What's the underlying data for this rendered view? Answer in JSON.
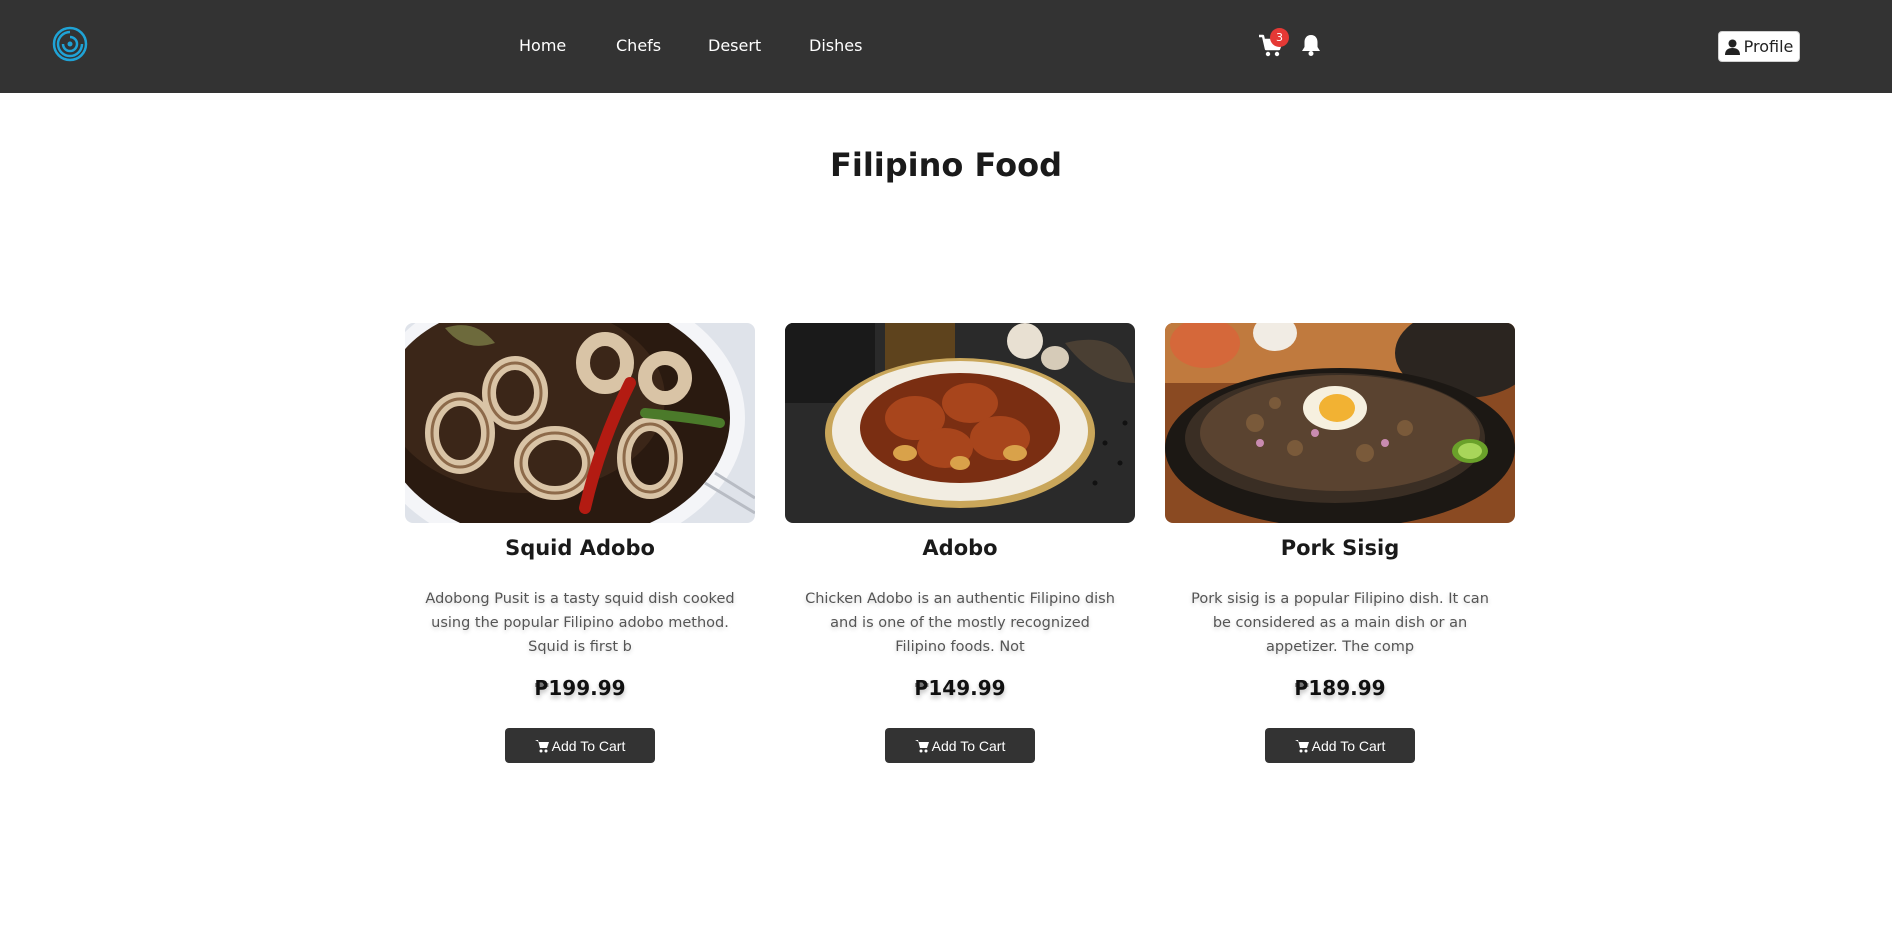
{
  "nav": {
    "links": [
      {
        "label": "Home"
      },
      {
        "label": "Chefs"
      },
      {
        "label": "Desert"
      },
      {
        "label": "Dishes"
      }
    ],
    "cart_count": "3",
    "profile_label": "Profile"
  },
  "page": {
    "title": "Filipino Food"
  },
  "cards": [
    {
      "title": "Squid Adobo",
      "description": "Adobong Pusit is a tasty squid dish cooked using the popular Filipino adobo method. Squid is first b",
      "price": "₱199.99",
      "button_label": "Add To Cart"
    },
    {
      "title": "Adobo",
      "description": "Chicken Adobo is an authentic Filipino dish and is one of the mostly recognized Filipino foods. Not",
      "price": "₱149.99",
      "button_label": "Add To Cart"
    },
    {
      "title": "Pork Sisig",
      "description": "Pork sisig is a popular Filipino dish. It can be considered as a main dish or an appetizer. The comp",
      "price": "₱189.99",
      "button_label": "Add To Cart"
    }
  ],
  "icons": {
    "logo": "swirl-logo-icon",
    "cart": "shopping-cart-icon",
    "bell": "bell-icon",
    "profile": "user-icon"
  },
  "colors": {
    "navbar_bg": "#333333",
    "button_bg": "#333333",
    "badge": "#e53935",
    "logo_accent": "#1fa3d6"
  }
}
